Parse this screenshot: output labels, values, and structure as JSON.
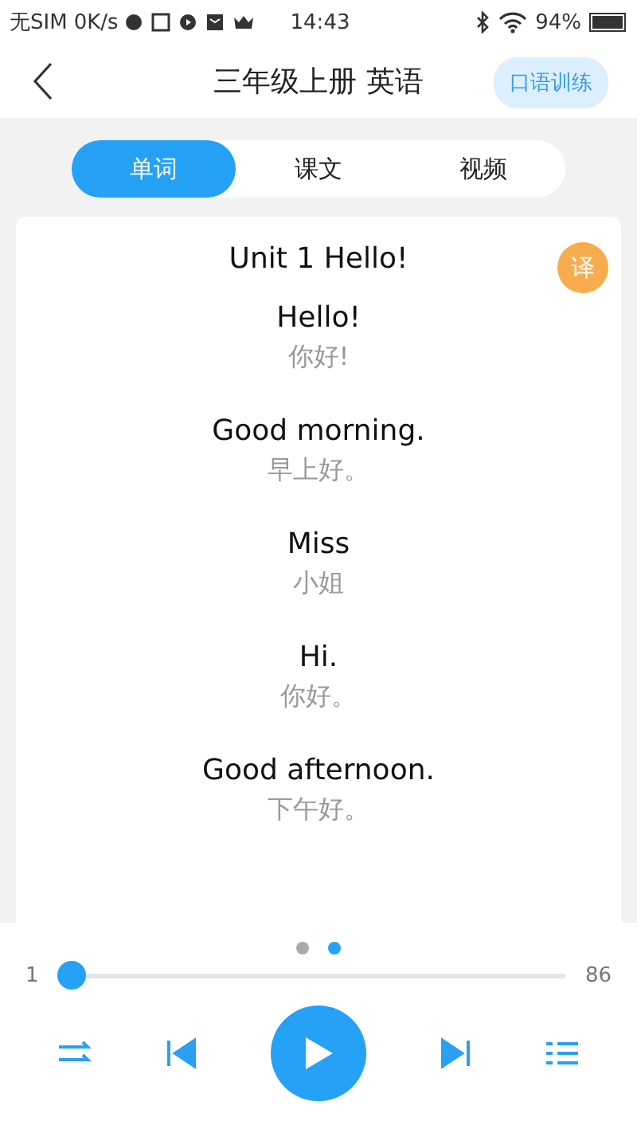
{
  "status_bar": {
    "carrier": "无SIM",
    "speed": "0K/s",
    "time": "14:43",
    "battery": "94%"
  },
  "header": {
    "title": "三年级上册 英语",
    "action": "口语训练"
  },
  "tabs": [
    {
      "label": "单词",
      "selected": true
    },
    {
      "label": "课文",
      "selected": false
    },
    {
      "label": "视频",
      "selected": false
    }
  ],
  "card": {
    "title": "Unit 1 Hello!",
    "translate_badge": "译",
    "entries": [
      {
        "english": "Hello!",
        "chinese": "你好!"
      },
      {
        "english": "Good morning.",
        "chinese": "早上好。"
      },
      {
        "english": "Miss",
        "chinese": "小姐"
      },
      {
        "english": "Hi.",
        "chinese": "你好。"
      },
      {
        "english": "Good afternoon.",
        "chinese": "下午好。"
      }
    ]
  },
  "pager": [
    {
      "selected": false
    },
    {
      "selected": true
    }
  ],
  "progress": {
    "start": "1",
    "end": "86",
    "level": 0
  }
}
